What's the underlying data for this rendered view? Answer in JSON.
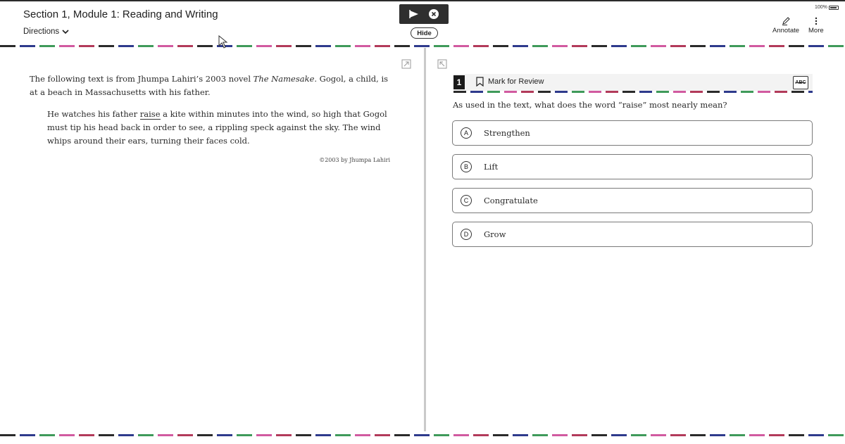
{
  "header": {
    "title": "Section 1, Module 1: Reading and Writing",
    "directions_label": "Directions",
    "hide_label": "Hide",
    "battery_text": "100%",
    "tools": [
      {
        "label": "Annotate",
        "icon": "pencil-icon"
      },
      {
        "label": "More",
        "icon": "more-vertical-icon"
      }
    ]
  },
  "passage": {
    "intro_before_title": "The following text is from Jhumpa Lahiri’s 2003 novel ",
    "intro_title": "The Namesake",
    "intro_after_title": ". Gogol, a child, is at a beach in Massachusetts with his father.",
    "quote_before": "He watches his father ",
    "quote_keyword": "raise",
    "quote_after": " a kite within minutes into the wind, so high that Gogol must tip his head back in order to see, a rippling speck against the sky. The wind whips around their ears, turning their faces cold.",
    "credit": "©2003 by Jhumpa Lahiri"
  },
  "question": {
    "number": "1",
    "mark_label": "Mark for Review",
    "eliminator_label": "ABC",
    "prompt": "As used in the text, what does the word “raise” most nearly mean?",
    "choices": [
      {
        "letter": "A",
        "text": "Strengthen"
      },
      {
        "letter": "B",
        "text": "Lift"
      },
      {
        "letter": "C",
        "text": "Congratulate"
      },
      {
        "letter": "D",
        "text": "Grow"
      }
    ]
  },
  "colors": {
    "dash_palette": [
      "#2e3a8c",
      "#b23a5a",
      "#3f9a5a",
      "#2a2a2a",
      "#d15aa0"
    ],
    "bar_dark": "#2f2f2f"
  }
}
